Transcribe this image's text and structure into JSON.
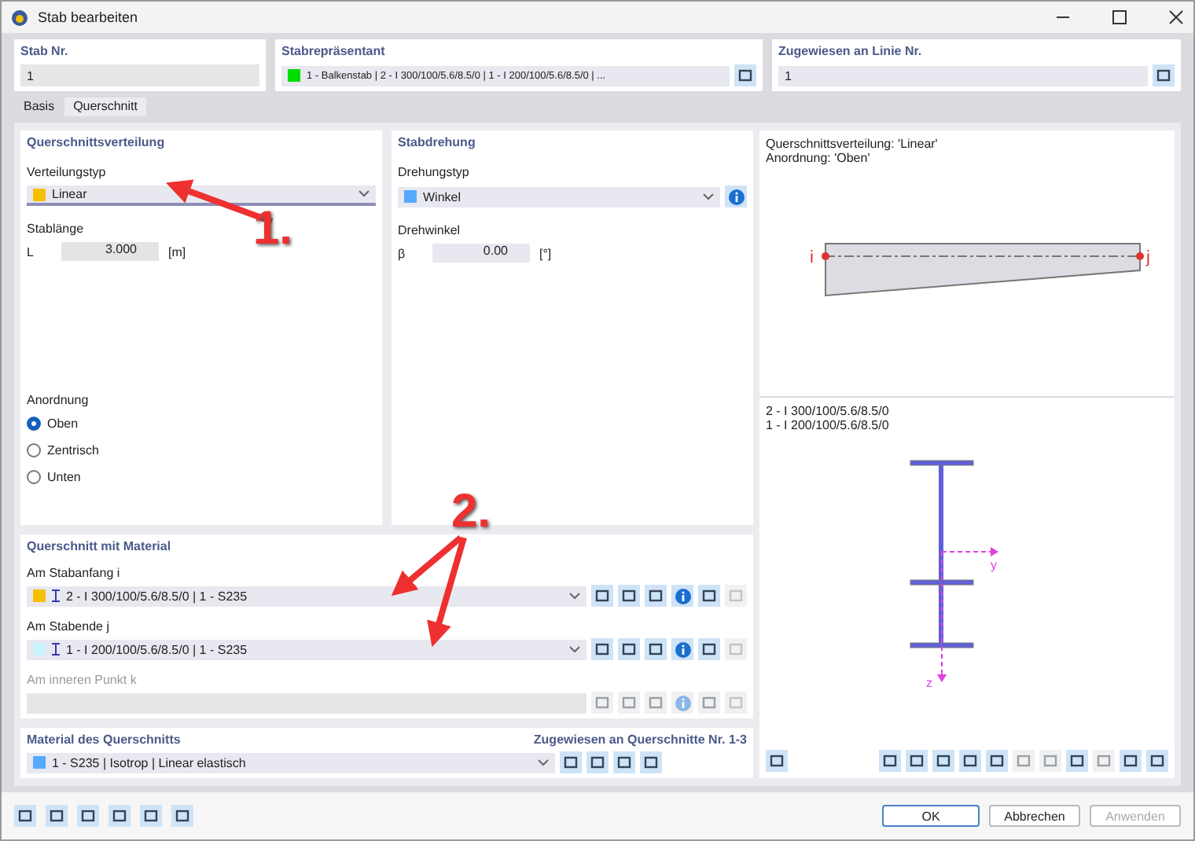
{
  "window": {
    "title": "Stab bearbeiten"
  },
  "header": {
    "member_no": {
      "label": "Stab Nr.",
      "value": "1"
    },
    "representative": {
      "label": "Stabrepräsentant",
      "value": "1 - Balkenstab | 2 - I 300/100/5.6/8.5/0 | 1 - I 200/100/5.6/8.5/0 | ...",
      "color": "#00dd00"
    },
    "assigned_line": {
      "label": "Zugewiesen an Linie Nr.",
      "value": "1"
    }
  },
  "tabs": [
    {
      "label": "Basis",
      "selected": false
    },
    {
      "label": "Querschnitt",
      "selected": true
    }
  ],
  "distribution": {
    "title": "Querschnittsverteilung",
    "type_label": "Verteilungstyp",
    "type": {
      "value": "Linear",
      "color": "#f5c000"
    },
    "length_label": "Stablänge",
    "length_symbol": "L",
    "length_value": "3.000",
    "length_unit": "[m]",
    "arrangement_label": "Anordnung",
    "arrangement_options": [
      {
        "label": "Oben",
        "selected": true
      },
      {
        "label": "Zentrisch",
        "selected": false
      },
      {
        "label": "Unten",
        "selected": false
      }
    ]
  },
  "rotation": {
    "title": "Stabdrehung",
    "type_label": "Drehungstyp",
    "type": {
      "value": "Winkel",
      "color": "#55aaff"
    },
    "angle_label": "Drehwinkel",
    "angle_symbol": "β",
    "angle_value": "0.00",
    "angle_unit": "[°]"
  },
  "sections": {
    "title": "Querschnitt mit Material",
    "rows": [
      {
        "label": "Am Stabanfang i",
        "value": "2 - I 300/100/5.6/8.5/0 | 1 - S235",
        "color": "#f5c000",
        "disabled": false
      },
      {
        "label": "Am Stabende j",
        "value": "1 - I 200/100/5.6/8.5/0 | 1 - S235",
        "color": "#ccf4ff",
        "disabled": false
      },
      {
        "label": "Am inneren Punkt k",
        "disabled": true
      }
    ]
  },
  "material": {
    "title": "Material des Querschnitts",
    "assigned": "Zugewiesen an Querschnitte Nr. 1-3",
    "value": "1 - S235 | Isotrop | Linear elastisch",
    "color": "#55aaff"
  },
  "preview": {
    "info_lines": [
      "Querschnittsverteilung: 'Linear'",
      "Anordnung: 'Oben'"
    ],
    "start_label": "i",
    "end_label": "j",
    "section_lines": [
      "2 - I 300/100/5.6/8.5/0",
      "1 - I 200/100/5.6/8.5/0"
    ],
    "axis_y": "y",
    "axis_z": "z"
  },
  "buttons": [
    {
      "label": "OK",
      "disabled": false
    },
    {
      "label": "Abbrechen",
      "disabled": false
    },
    {
      "label": "Anwenden",
      "disabled": true
    }
  ],
  "annotations": [
    {
      "label": "1."
    },
    {
      "label": "2."
    }
  ]
}
